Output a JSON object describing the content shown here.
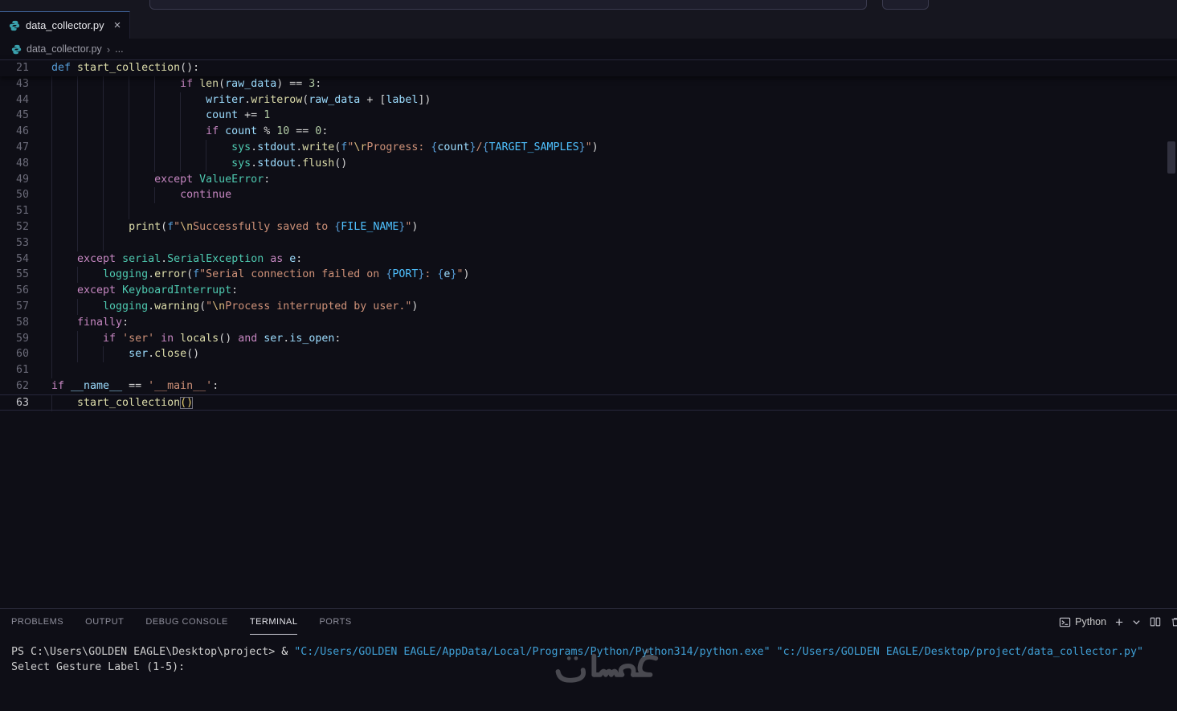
{
  "titlebar": {
    "command_center_value": ""
  },
  "tab": {
    "filename": "data_collector.py"
  },
  "glyphs": {
    "close": "×",
    "separator": "›",
    "plus": "+",
    "more": "..."
  },
  "breadcrumb": {
    "file": "data_collector.py",
    "more": "..."
  },
  "editor": {
    "current_line": 63,
    "sticky": {
      "ln": 21,
      "indent": 0,
      "tokens": [
        [
          "df",
          "def"
        ],
        [
          "tx",
          " "
        ],
        [
          "fn",
          "start_collection"
        ],
        [
          "pu",
          "():"
        ]
      ]
    },
    "lines": [
      {
        "ln": 43,
        "indent": 20,
        "tokens": [
          [
            "kw",
            "if"
          ],
          [
            "tx",
            " "
          ],
          [
            "fn",
            "len"
          ],
          [
            "pu",
            "("
          ],
          [
            "vr",
            "raw_data"
          ],
          [
            "pu",
            ")"
          ],
          [
            "tx",
            " "
          ],
          [
            "pu",
            "=="
          ],
          [
            "tx",
            " "
          ],
          [
            "nu",
            "3"
          ],
          [
            "pu",
            ":"
          ]
        ]
      },
      {
        "ln": 44,
        "indent": 24,
        "tokens": [
          [
            "vr",
            "writer"
          ],
          [
            "pu",
            "."
          ],
          [
            "fn",
            "writerow"
          ],
          [
            "pu",
            "("
          ],
          [
            "vr",
            "raw_data"
          ],
          [
            "tx",
            " "
          ],
          [
            "pu",
            "+"
          ],
          [
            "tx",
            " "
          ],
          [
            "pu",
            "["
          ],
          [
            "vr",
            "label"
          ],
          [
            "pu",
            "])"
          ]
        ]
      },
      {
        "ln": 45,
        "indent": 24,
        "tokens": [
          [
            "vr",
            "count"
          ],
          [
            "tx",
            " "
          ],
          [
            "pu",
            "+="
          ],
          [
            "tx",
            " "
          ],
          [
            "nu",
            "1"
          ]
        ]
      },
      {
        "ln": 46,
        "indent": 24,
        "tokens": [
          [
            "kw",
            "if"
          ],
          [
            "tx",
            " "
          ],
          [
            "vr",
            "count"
          ],
          [
            "tx",
            " "
          ],
          [
            "pu",
            "%"
          ],
          [
            "tx",
            " "
          ],
          [
            "nu",
            "10"
          ],
          [
            "tx",
            " "
          ],
          [
            "pu",
            "=="
          ],
          [
            "tx",
            " "
          ],
          [
            "nu",
            "0"
          ],
          [
            "pu",
            ":"
          ]
        ]
      },
      {
        "ln": 47,
        "indent": 28,
        "tokens": [
          [
            "cl",
            "sys"
          ],
          [
            "pu",
            "."
          ],
          [
            "vr",
            "stdout"
          ],
          [
            "pu",
            "."
          ],
          [
            "fn",
            "write"
          ],
          [
            "pu",
            "("
          ],
          [
            "df",
            "f"
          ],
          [
            "st",
            "\""
          ],
          [
            "es",
            "\\r"
          ],
          [
            "st",
            "Progress: "
          ],
          [
            "br",
            "{"
          ],
          [
            "vr",
            "count"
          ],
          [
            "br",
            "}"
          ],
          [
            "st",
            "/"
          ],
          [
            "br",
            "{"
          ],
          [
            "co",
            "TARGET_SAMPLES"
          ],
          [
            "br",
            "}"
          ],
          [
            "st",
            "\""
          ],
          [
            "pu",
            ")"
          ]
        ]
      },
      {
        "ln": 48,
        "indent": 28,
        "tokens": [
          [
            "cl",
            "sys"
          ],
          [
            "pu",
            "."
          ],
          [
            "vr",
            "stdout"
          ],
          [
            "pu",
            "."
          ],
          [
            "fn",
            "flush"
          ],
          [
            "pu",
            "()"
          ]
        ]
      },
      {
        "ln": 49,
        "indent": 16,
        "tokens": [
          [
            "kw",
            "except"
          ],
          [
            "tx",
            " "
          ],
          [
            "cl",
            "ValueError"
          ],
          [
            "pu",
            ":"
          ]
        ]
      },
      {
        "ln": 50,
        "indent": 20,
        "tokens": [
          [
            "kw",
            "continue"
          ]
        ]
      },
      {
        "ln": 51,
        "indent": 0,
        "g": 16,
        "tokens": []
      },
      {
        "ln": 52,
        "indent": 12,
        "tokens": [
          [
            "fn",
            "print"
          ],
          [
            "pu",
            "("
          ],
          [
            "df",
            "f"
          ],
          [
            "st",
            "\""
          ],
          [
            "es",
            "\\n"
          ],
          [
            "st",
            "Successfully saved to "
          ],
          [
            "br",
            "{"
          ],
          [
            "co",
            "FILE_NAME"
          ],
          [
            "br",
            "}"
          ],
          [
            "st",
            "\""
          ],
          [
            "pu",
            ")"
          ]
        ]
      },
      {
        "ln": 53,
        "indent": 0,
        "g": 12,
        "tokens": []
      },
      {
        "ln": 54,
        "indent": 4,
        "tokens": [
          [
            "kw",
            "except"
          ],
          [
            "tx",
            " "
          ],
          [
            "cl",
            "serial"
          ],
          [
            "pu",
            "."
          ],
          [
            "cl",
            "SerialException"
          ],
          [
            "tx",
            " "
          ],
          [
            "kw",
            "as"
          ],
          [
            "tx",
            " "
          ],
          [
            "vr",
            "e"
          ],
          [
            "pu",
            ":"
          ]
        ]
      },
      {
        "ln": 55,
        "indent": 8,
        "tokens": [
          [
            "cl",
            "logging"
          ],
          [
            "pu",
            "."
          ],
          [
            "fn",
            "error"
          ],
          [
            "pu",
            "("
          ],
          [
            "df",
            "f"
          ],
          [
            "st",
            "\"Serial connection failed on "
          ],
          [
            "br",
            "{"
          ],
          [
            "co",
            "PORT"
          ],
          [
            "br",
            "}"
          ],
          [
            "st",
            ": "
          ],
          [
            "br",
            "{"
          ],
          [
            "vr",
            "e"
          ],
          [
            "br",
            "}"
          ],
          [
            "st",
            "\""
          ],
          [
            "pu",
            ")"
          ]
        ]
      },
      {
        "ln": 56,
        "indent": 4,
        "tokens": [
          [
            "kw",
            "except"
          ],
          [
            "tx",
            " "
          ],
          [
            "cl",
            "KeyboardInterrupt"
          ],
          [
            "pu",
            ":"
          ]
        ]
      },
      {
        "ln": 57,
        "indent": 8,
        "tokens": [
          [
            "cl",
            "logging"
          ],
          [
            "pu",
            "."
          ],
          [
            "fn",
            "warning"
          ],
          [
            "pu",
            "("
          ],
          [
            "st",
            "\""
          ],
          [
            "es",
            "\\n"
          ],
          [
            "st",
            "Process interrupted by user.\""
          ],
          [
            "pu",
            ")"
          ]
        ]
      },
      {
        "ln": 58,
        "indent": 4,
        "tokens": [
          [
            "kw",
            "finally"
          ],
          [
            "pu",
            ":"
          ]
        ]
      },
      {
        "ln": 59,
        "indent": 8,
        "tokens": [
          [
            "kw",
            "if"
          ],
          [
            "tx",
            " "
          ],
          [
            "st",
            "'ser'"
          ],
          [
            "tx",
            " "
          ],
          [
            "kw",
            "in"
          ],
          [
            "tx",
            " "
          ],
          [
            "fn",
            "locals"
          ],
          [
            "pu",
            "()"
          ],
          [
            "tx",
            " "
          ],
          [
            "kw",
            "and"
          ],
          [
            "tx",
            " "
          ],
          [
            "vr",
            "ser"
          ],
          [
            "pu",
            "."
          ],
          [
            "vr",
            "is_open"
          ],
          [
            "pu",
            ":"
          ]
        ]
      },
      {
        "ln": 60,
        "indent": 12,
        "tokens": [
          [
            "vr",
            "ser"
          ],
          [
            "pu",
            "."
          ],
          [
            "fn",
            "close"
          ],
          [
            "pu",
            "()"
          ]
        ]
      },
      {
        "ln": 61,
        "indent": 0,
        "g": 4,
        "tokens": []
      },
      {
        "ln": 62,
        "indent": 0,
        "tokens": [
          [
            "kw",
            "if"
          ],
          [
            "tx",
            " "
          ],
          [
            "vr",
            "__name__"
          ],
          [
            "tx",
            " "
          ],
          [
            "pu",
            "=="
          ],
          [
            "tx",
            " "
          ],
          [
            "st",
            "'__main__'"
          ],
          [
            "pu",
            ":"
          ]
        ]
      },
      {
        "ln": 63,
        "indent": 4,
        "tokens": [
          [
            "fn",
            "start_collection"
          ],
          [
            "bx",
            "()"
          ]
        ]
      }
    ]
  },
  "panel": {
    "tabs": [
      {
        "label": "PROBLEMS"
      },
      {
        "label": "OUTPUT"
      },
      {
        "label": "DEBUG CONSOLE"
      },
      {
        "label": "TERMINAL"
      },
      {
        "label": "PORTS"
      }
    ],
    "active_tab": "TERMINAL",
    "terminal_selector_label": "Python"
  },
  "terminal": {
    "lines": [
      {
        "tokens": [
          [
            "tp",
            "PS C:\\Users\\GOLDEN EAGLE\\Desktop\\project> "
          ],
          [
            "ta",
            "& "
          ],
          [
            "ts",
            "\"C:/Users/GOLDEN EAGLE/AppData/Local/Programs/Python/Python314/python.exe\""
          ],
          [
            "tp",
            " "
          ],
          [
            "ts",
            "\"c:/Users/GOLDEN EAGLE/Desktop/project/data_collector.py\""
          ]
        ]
      },
      {
        "tokens": [
          [
            "tp",
            "Select Gesture Label (1-5): "
          ]
        ]
      }
    ]
  },
  "watermark": {
    "text": "خمسات"
  }
}
